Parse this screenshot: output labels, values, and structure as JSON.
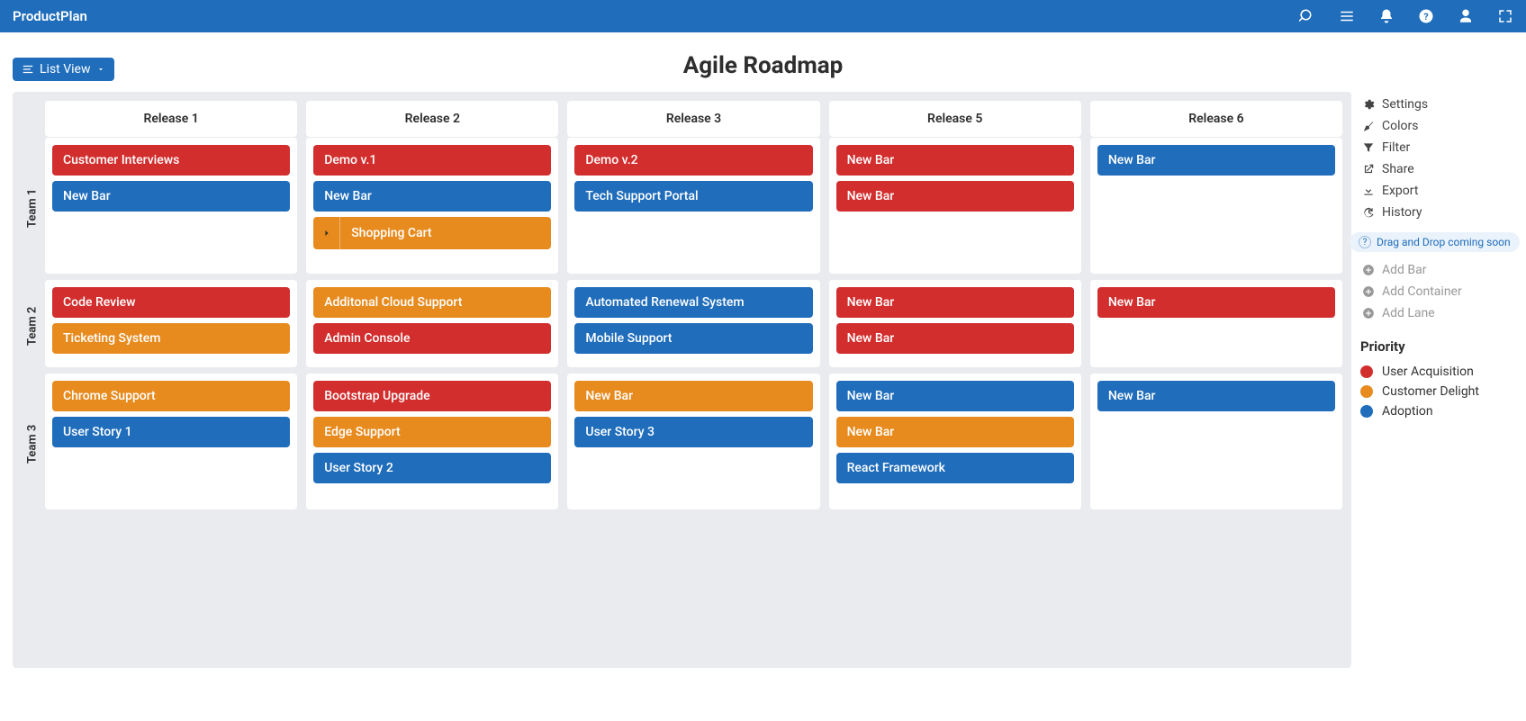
{
  "app": {
    "brand": "ProductPlan"
  },
  "title": "Agile Roadmap",
  "view_toggle": "List View",
  "releases": [
    "Release 1",
    "Release 2",
    "Release 3",
    "Release 5",
    "Release 6"
  ],
  "teams": [
    "Team 1",
    "Team 2",
    "Team 3"
  ],
  "board": {
    "r1": {
      "t1": [
        {
          "label": "Customer Interviews",
          "color": "red"
        },
        {
          "label": "New Bar",
          "color": "blue"
        }
      ],
      "t2": [
        {
          "label": "Code Review",
          "color": "red"
        },
        {
          "label": "Ticketing System",
          "color": "orange"
        }
      ],
      "t3": [
        {
          "label": "Chrome Support",
          "color": "orange"
        },
        {
          "label": "User Story 1",
          "color": "blue"
        }
      ]
    },
    "r2": {
      "t1": [
        {
          "label": "Demo v.1",
          "color": "red"
        },
        {
          "label": "New Bar",
          "color": "blue"
        },
        {
          "label": "Shopping Cart",
          "color": "orange",
          "container": true
        }
      ],
      "t2": [
        {
          "label": "Additonal Cloud Support",
          "color": "orange"
        },
        {
          "label": "Admin Console",
          "color": "red"
        }
      ],
      "t3": [
        {
          "label": "Bootstrap Upgrade",
          "color": "red"
        },
        {
          "label": "Edge Support",
          "color": "orange"
        },
        {
          "label": "User Story 2",
          "color": "blue"
        }
      ]
    },
    "r3": {
      "t1": [
        {
          "label": "Demo v.2",
          "color": "red"
        },
        {
          "label": "Tech Support Portal",
          "color": "blue"
        }
      ],
      "t2": [
        {
          "label": "Automated Renewal System",
          "color": "blue"
        },
        {
          "label": "Mobile Support",
          "color": "blue"
        }
      ],
      "t3": [
        {
          "label": "New Bar",
          "color": "orange"
        },
        {
          "label": "User Story 3",
          "color": "blue"
        }
      ]
    },
    "r5": {
      "t1": [
        {
          "label": "New Bar",
          "color": "red"
        },
        {
          "label": "New Bar",
          "color": "red"
        }
      ],
      "t2": [
        {
          "label": "New Bar",
          "color": "red"
        },
        {
          "label": "New Bar",
          "color": "red"
        }
      ],
      "t3": [
        {
          "label": "New Bar",
          "color": "blue"
        },
        {
          "label": "New Bar",
          "color": "orange"
        },
        {
          "label": "React Framework",
          "color": "blue"
        }
      ]
    },
    "r6": {
      "t1": [
        {
          "label": "New Bar",
          "color": "blue"
        }
      ],
      "t2": [
        {
          "label": "New Bar",
          "color": "red"
        }
      ],
      "t3": [
        {
          "label": "New Bar",
          "color": "blue"
        }
      ]
    }
  },
  "sidebar": {
    "settings": "Settings",
    "colors": "Colors",
    "filter": "Filter",
    "share": "Share",
    "export": "Export",
    "history": "History",
    "dragdrop": "Drag and Drop coming soon",
    "add_bar": "Add Bar",
    "add_container": "Add Container",
    "add_lane": "Add Lane",
    "legend_title": "Priority",
    "legend": [
      {
        "label": "User Acquisition",
        "color": "red"
      },
      {
        "label": "Customer Delight",
        "color": "orange"
      },
      {
        "label": "Adoption",
        "color": "blue"
      }
    ]
  },
  "row_heights": {
    "t1": 152,
    "t2": 98,
    "t3": 152
  }
}
